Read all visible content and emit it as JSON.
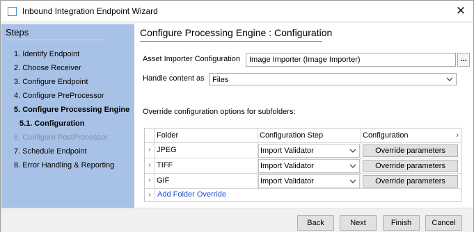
{
  "window": {
    "title": "Inbound Integration Endpoint Wizard",
    "close_glyph": "✕"
  },
  "steps": {
    "title": "Steps",
    "items": [
      {
        "label": "1. Identify Endpoint",
        "state": "normal"
      },
      {
        "label": "2. Choose Receiver",
        "state": "normal"
      },
      {
        "label": "3. Configure Endpoint",
        "state": "normal"
      },
      {
        "label": "4. Configure PreProcessor",
        "state": "normal"
      },
      {
        "label": "5. Configure Processing Engine",
        "state": "active"
      },
      {
        "label": "5.1. Configuration",
        "state": "sub-active"
      },
      {
        "label": "6. Configure PostProcessor",
        "state": "disabled"
      },
      {
        "label": "7. Schedule Endpoint",
        "state": "normal"
      },
      {
        "label": "8. Error Handling & Reporting",
        "state": "normal"
      }
    ]
  },
  "main": {
    "heading": "Configure Processing Engine : Configuration",
    "asset_importer_label": "Asset Importer Configuration",
    "asset_importer_value": "Image Importer (Image Importer)",
    "browse_label": "...",
    "handle_content_label": "Handle content as",
    "handle_content_value": "Files",
    "override_label": "Override configuration options for subfolders:"
  },
  "table": {
    "columns": [
      "Folder",
      "Configuration Step",
      "Configuration"
    ],
    "rows": [
      {
        "folder": "JPEG",
        "step": "Import Validator",
        "action": "Override parameters"
      },
      {
        "folder": "TIFF",
        "step": "Import Validator",
        "action": "Override parameters"
      },
      {
        "folder": "GIF",
        "step": "Import Validator",
        "action": "Override parameters"
      }
    ],
    "row_marker": "›",
    "header_marker": "›",
    "add_link": "Add Folder Override"
  },
  "footer": {
    "back": "Back",
    "next": "Next",
    "finish": "Finish",
    "cancel": "Cancel"
  },
  "colors": {
    "steps_panel": "#a8c1e6",
    "link": "#1d4fd0",
    "disabled_text": "#7d8ea6"
  }
}
